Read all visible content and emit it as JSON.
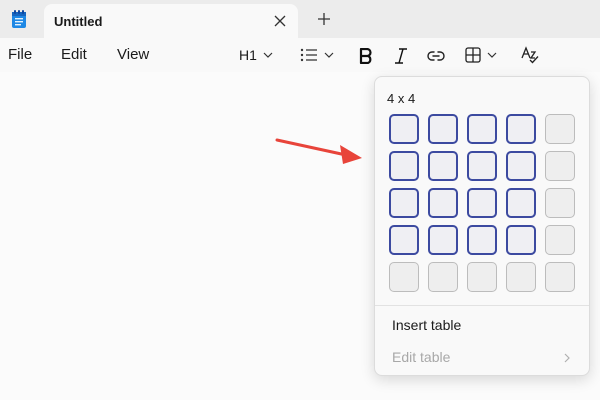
{
  "tab": {
    "title": "Untitled"
  },
  "menu": {
    "file": "File",
    "edit": "Edit",
    "view": "View"
  },
  "toolbar": {
    "heading": "H1"
  },
  "table_picker": {
    "size_label": "4 x 4",
    "selected_rows": 4,
    "selected_cols": 4,
    "total_rows": 5,
    "total_cols": 5,
    "insert_label": "Insert table",
    "edit_label": "Edit table"
  },
  "colors": {
    "selected_cell_border": "#3c4aa0",
    "annotation_arrow": "#e8443a",
    "app_icon": "#1e88e5"
  },
  "icons": [
    "notepad-icon",
    "close-icon",
    "plus-icon",
    "chevron-down-icon",
    "list-icon",
    "bold-icon",
    "italic-icon",
    "link-icon",
    "table-icon",
    "spellcheck-icon",
    "chevron-right-icon",
    "arrow-icon"
  ]
}
